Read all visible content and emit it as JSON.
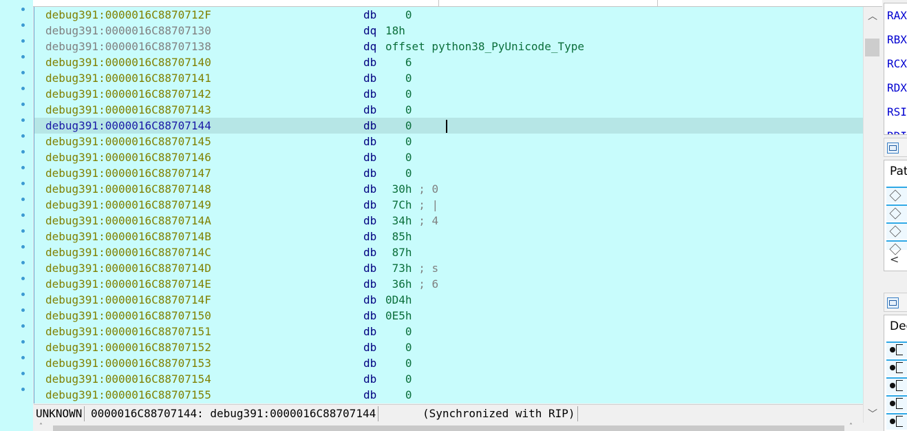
{
  "listing": {
    "rows": [
      {
        "addr": "debug391:0000016C8870712F",
        "mn": "db",
        "op": "0",
        "cmt": ""
      },
      {
        "addr": "debug391:0000016C88707130",
        "mn": "dq",
        "op": "18h",
        "cmt": ""
      },
      {
        "addr": "debug391:0000016C88707138",
        "mn": "dq",
        "op": "offset python38_PyUnicode_Type",
        "cmt": ""
      },
      {
        "addr": "debug391:0000016C88707140",
        "mn": "db",
        "op": "6",
        "cmt": ""
      },
      {
        "addr": "debug391:0000016C88707141",
        "mn": "db",
        "op": "0",
        "cmt": ""
      },
      {
        "addr": "debug391:0000016C88707142",
        "mn": "db",
        "op": "0",
        "cmt": ""
      },
      {
        "addr": "debug391:0000016C88707143",
        "mn": "db",
        "op": "0",
        "cmt": ""
      },
      {
        "addr": "debug391:0000016C88707144",
        "mn": "db",
        "op": "0",
        "cmt": ""
      },
      {
        "addr": "debug391:0000016C88707145",
        "mn": "db",
        "op": "0",
        "cmt": ""
      },
      {
        "addr": "debug391:0000016C88707146",
        "mn": "db",
        "op": "0",
        "cmt": ""
      },
      {
        "addr": "debug391:0000016C88707147",
        "mn": "db",
        "op": "0",
        "cmt": ""
      },
      {
        "addr": "debug391:0000016C88707148",
        "mn": "db",
        "op": "30h",
        "cmt": "; 0"
      },
      {
        "addr": "debug391:0000016C88707149",
        "mn": "db",
        "op": "7Ch",
        "cmt": "; |"
      },
      {
        "addr": "debug391:0000016C8870714A",
        "mn": "db",
        "op": "34h",
        "cmt": "; 4"
      },
      {
        "addr": "debug391:0000016C8870714B",
        "mn": "db",
        "op": "85h",
        "cmt": ""
      },
      {
        "addr": "debug391:0000016C8870714C",
        "mn": "db",
        "op": "87h",
        "cmt": ""
      },
      {
        "addr": "debug391:0000016C8870714D",
        "mn": "db",
        "op": "73h",
        "cmt": "; s"
      },
      {
        "addr": "debug391:0000016C8870714E",
        "mn": "db",
        "op": "36h",
        "cmt": "; 6"
      },
      {
        "addr": "debug391:0000016C8870714F",
        "mn": "db",
        "op": "0D4h",
        "cmt": ""
      },
      {
        "addr": "debug391:0000016C88707150",
        "mn": "db",
        "op": "0E5h",
        "cmt": ""
      },
      {
        "addr": "debug391:0000016C88707151",
        "mn": "db",
        "op": "0",
        "cmt": ""
      },
      {
        "addr": "debug391:0000016C88707152",
        "mn": "db",
        "op": "0",
        "cmt": ""
      },
      {
        "addr": "debug391:0000016C88707153",
        "mn": "db",
        "op": "0",
        "cmt": ""
      },
      {
        "addr": "debug391:0000016C88707154",
        "mn": "db",
        "op": "0",
        "cmt": ""
      },
      {
        "addr": "debug391:0000016C88707155",
        "mn": "db",
        "op": "0",
        "cmt": ""
      }
    ]
  },
  "status": {
    "segment": "UNKNOWN",
    "location": "0000016C88707144: debug391:0000016C88707144",
    "sync": "(Synchronized with RIP)"
  },
  "registers": [
    "RAX",
    "RBX",
    "RCX",
    "RDX",
    "RSI",
    "RDI"
  ],
  "panel_path": {
    "label": "Pat"
  },
  "panel_dec": {
    "label": "Dec"
  },
  "colors": {
    "listing_bg": "#c8fcfc",
    "selected_row": "#b6e6e6",
    "address_color": "#808000",
    "mnemonic_color": "#000080",
    "operand_color": "#008040",
    "register_color": "#0000d0"
  }
}
